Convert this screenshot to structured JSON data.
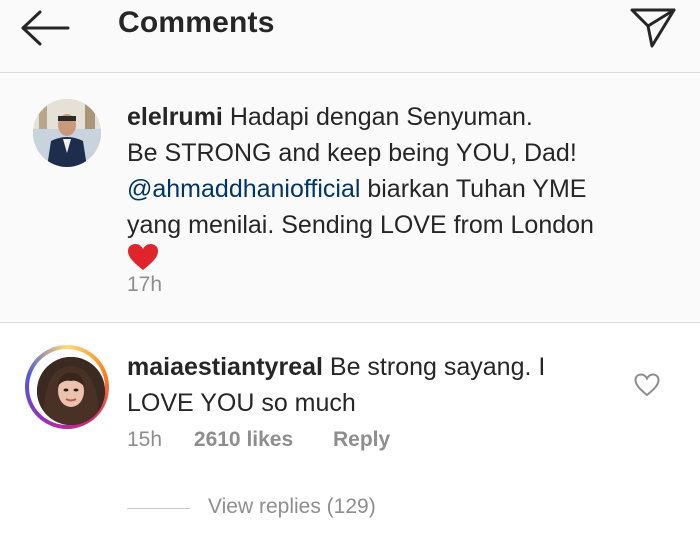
{
  "header": {
    "title": "Comments",
    "back_icon": "arrow-left-icon",
    "send_icon": "paper-plane-icon"
  },
  "caption": {
    "username": "elelrumi",
    "line1": "Hadapi dengan Senyuman.",
    "line2": "Be STRONG and keep being YOU, Dad!",
    "mention": "@ahmaddhaniofficial",
    "line3_rest": " biarkan Tuhan YME",
    "line4": "yang menilai. Sending LOVE from London",
    "emoji": "heart-icon",
    "time": "17h"
  },
  "comment": {
    "username": "maiaestiantyreal",
    "text_line1": "Be strong sayang. I",
    "text_line2": "LOVE YOU so much",
    "time": "15h",
    "likes": "2610 likes",
    "reply_label": "Reply",
    "view_replies": "View replies (129)",
    "like_icon": "heart-outline-icon"
  },
  "colors": {
    "mention": "#003569",
    "meta_gray": "#8e8e8e",
    "heart": "#ed4956"
  }
}
